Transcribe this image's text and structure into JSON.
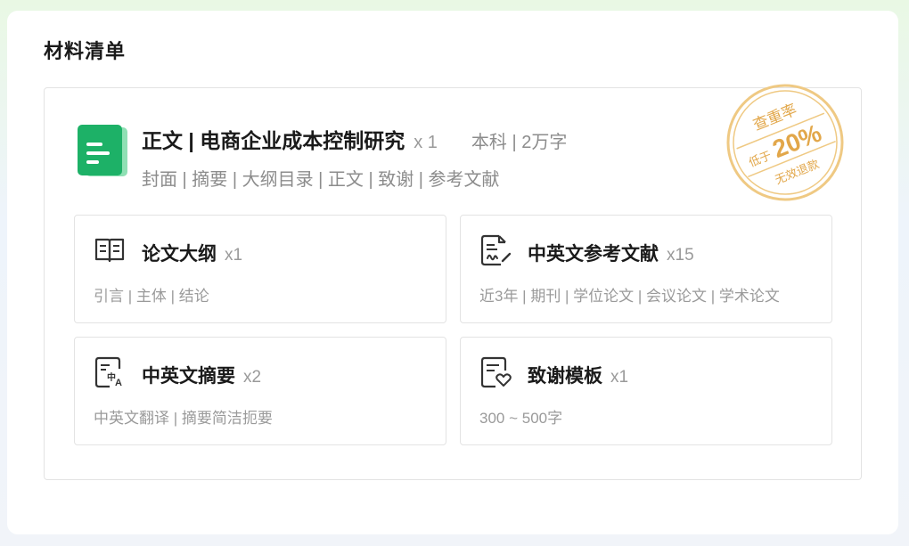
{
  "section": {
    "title": "材料清单"
  },
  "main": {
    "icon": "green-document-icon",
    "title": "正文 | 电商企业成本控制研究",
    "quantity": "x 1",
    "level": "本科 | 2万字",
    "contents": "封面 | 摘要 | 大纲目录 | 正文 | 致谢 | 参考文献"
  },
  "stamp": {
    "top_text": "查重率",
    "low_text": "低于",
    "percent": "20%",
    "bottom_text": "无效退款",
    "color": "#e8b45a"
  },
  "cards": [
    {
      "icon": "open-book-icon",
      "title": "论文大纲",
      "quantity": "x1",
      "description": "引言 | 主体 | 结论"
    },
    {
      "icon": "signed-document-icon",
      "title": "中英文参考文献",
      "quantity": "x15",
      "description": "近3年 | 期刊 | 学位论文 | 会议论文 | 学术论文"
    },
    {
      "icon": "translate-document-icon",
      "title": "中英文摘要",
      "quantity": "x2",
      "description": "中英文翻译 | 摘要简洁扼要"
    },
    {
      "icon": "heart-document-icon",
      "title": "致谢模板",
      "quantity": "x1",
      "description": "300 ~ 500字"
    }
  ],
  "colors": {
    "accent_green": "#1db167",
    "text_dark": "#1a1a1a",
    "text_muted": "#9a9a9a"
  }
}
